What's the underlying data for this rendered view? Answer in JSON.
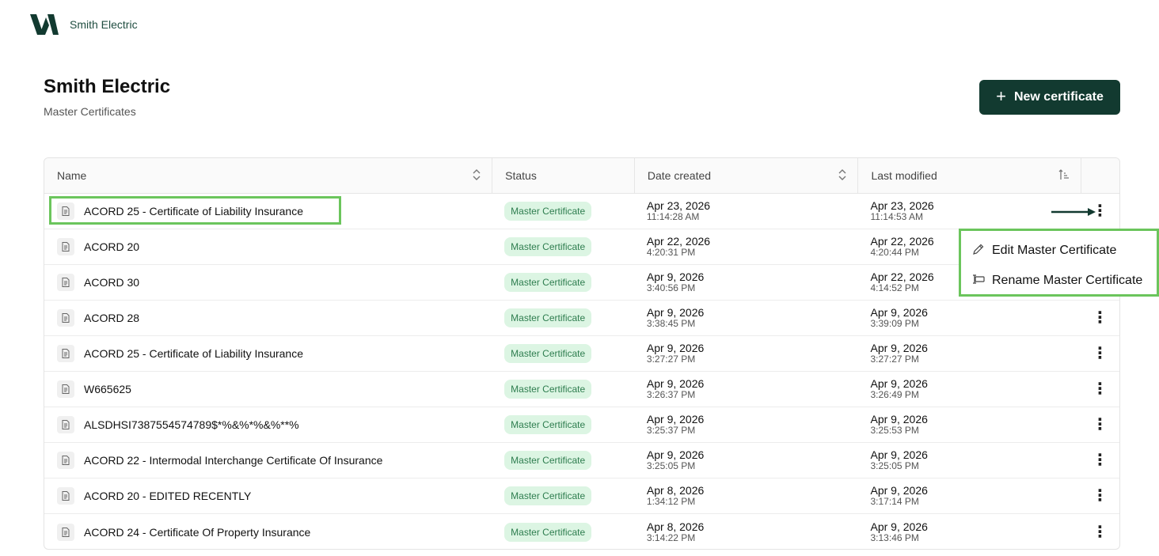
{
  "header": {
    "company": "Smith Electric"
  },
  "page": {
    "title": "Smith Electric",
    "subtitle": "Master Certificates",
    "new_button_label": "New certificate"
  },
  "table": {
    "columns": [
      "Name",
      "Status",
      "Date created",
      "Last modified"
    ],
    "rows": [
      {
        "name": "ACORD 25 - Certificate of Liability Insurance",
        "status": "Master Certificate",
        "created_date": "Apr 23, 2026",
        "created_time": "11:14:28 AM",
        "modified_date": "Apr 23, 2026",
        "modified_time": "11:14:53 AM"
      },
      {
        "name": "ACORD 20",
        "status": "Master Certificate",
        "created_date": "Apr 22, 2026",
        "created_time": "4:20:31 PM",
        "modified_date": "Apr 22, 2026",
        "modified_time": "4:20:44 PM"
      },
      {
        "name": "ACORD 30",
        "status": "Master Certificate",
        "created_date": "Apr 9, 2026",
        "created_time": "3:40:56 PM",
        "modified_date": "Apr 22, 2026",
        "modified_time": "4:14:52 PM"
      },
      {
        "name": "ACORD 28",
        "status": "Master Certificate",
        "created_date": "Apr 9, 2026",
        "created_time": "3:38:45 PM",
        "modified_date": "Apr 9, 2026",
        "modified_time": "3:39:09 PM"
      },
      {
        "name": "ACORD 25 - Certificate of Liability Insurance",
        "status": "Master Certificate",
        "created_date": "Apr 9, 2026",
        "created_time": "3:27:27 PM",
        "modified_date": "Apr 9, 2026",
        "modified_time": "3:27:27 PM"
      },
      {
        "name": "W665625",
        "status": "Master Certificate",
        "created_date": "Apr 9, 2026",
        "created_time": "3:26:37 PM",
        "modified_date": "Apr 9, 2026",
        "modified_time": "3:26:49 PM"
      },
      {
        "name": "ALSDHSI7387554574789$*%&%*%&%**%",
        "status": "Master Certificate",
        "created_date": "Apr 9, 2026",
        "created_time": "3:25:37 PM",
        "modified_date": "Apr 9, 2026",
        "modified_time": "3:25:53 PM"
      },
      {
        "name": "ACORD 22 - Intermodal Interchange Certificate Of Insurance",
        "status": "Master Certificate",
        "created_date": "Apr 9, 2026",
        "created_time": "3:25:05 PM",
        "modified_date": "Apr 9, 2026",
        "modified_time": "3:25:05 PM"
      },
      {
        "name": "ACORD 20 - EDITED RECENTLY",
        "status": "Master Certificate",
        "created_date": "Apr 8, 2026",
        "created_time": "1:34:12 PM",
        "modified_date": "Apr 9, 2026",
        "modified_time": "3:17:14 PM"
      },
      {
        "name": "ACORD 24 - Certificate Of Property Insurance",
        "status": "Master Certificate",
        "created_date": "Apr 8, 2026",
        "created_time": "3:14:22 PM",
        "modified_date": "Apr 9, 2026",
        "modified_time": "3:13:46 PM"
      }
    ]
  },
  "context_menu": {
    "items": [
      "Edit Master Certificate",
      "Rename Master Certificate"
    ]
  },
  "colors": {
    "brand": "#123a30",
    "badge_bg": "#dcf5e3",
    "badge_text": "#2e7d4f",
    "highlight": "#6bc55c"
  }
}
